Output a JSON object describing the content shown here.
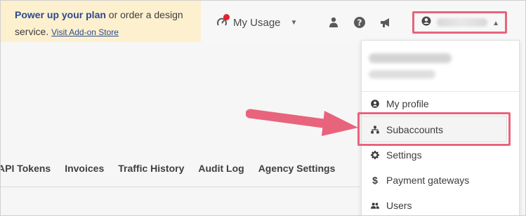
{
  "promo": {
    "bold": "Power up your plan",
    "text": " or order a design service.",
    "link": "Visit Add-on Store"
  },
  "header": {
    "usage_label": "My Usage",
    "icons": [
      "usage-icon",
      "users-icon",
      "help-icon",
      "megaphone-icon",
      "account-icon"
    ]
  },
  "subnav": {
    "items": [
      "API Tokens",
      "Invoices",
      "Traffic History",
      "Audit Log",
      "Agency Settings"
    ]
  },
  "dropdown": {
    "items": [
      {
        "label": "My profile",
        "icon": "user-circle-icon"
      },
      {
        "label": "Subaccounts",
        "icon": "hierarchy-icon"
      },
      {
        "label": "Settings",
        "icon": "gear-icon"
      },
      {
        "label": "Payment gateways",
        "icon": "dollar-icon"
      },
      {
        "label": "Users",
        "icon": "users-icon"
      }
    ]
  },
  "colors": {
    "highlight": "#e8647c",
    "promo_bg": "#fdf0cf",
    "link": "#2b4a8c",
    "badge": "#e5202f"
  }
}
